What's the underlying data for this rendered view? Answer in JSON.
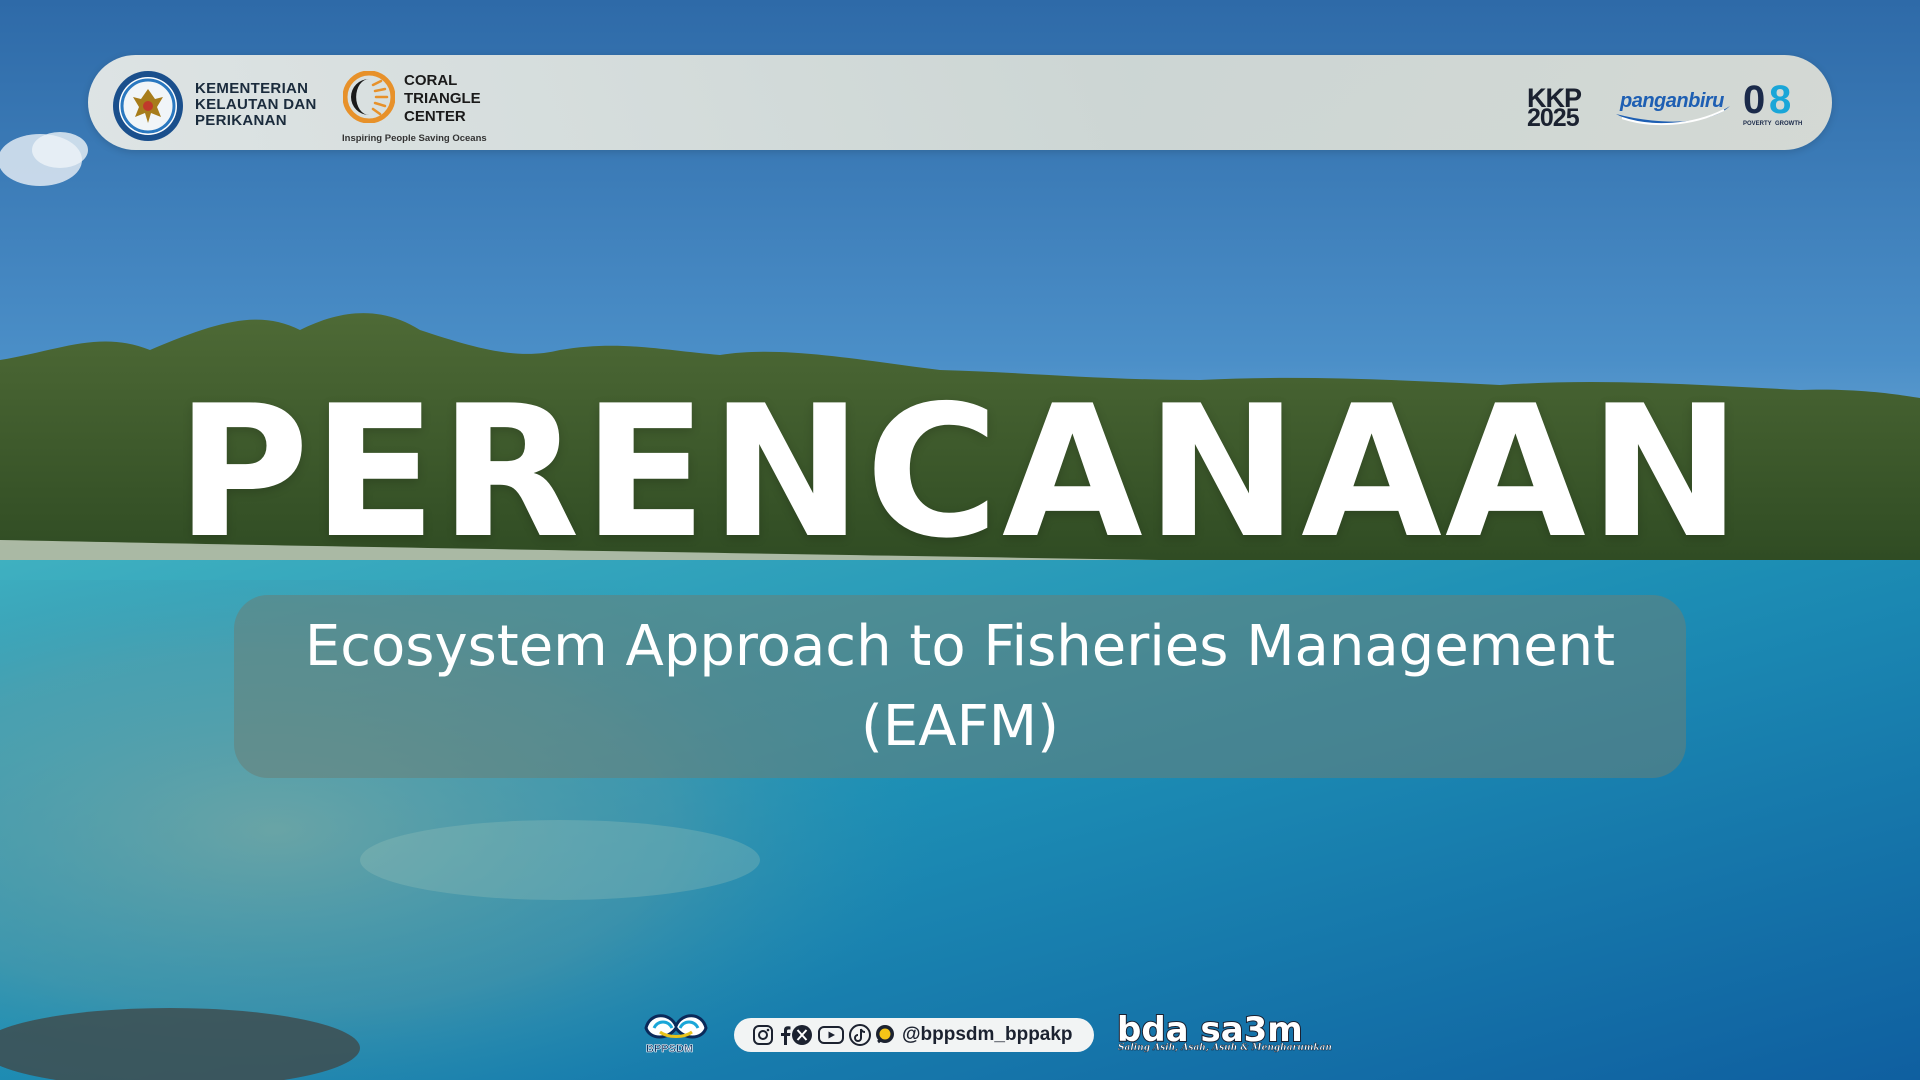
{
  "header": {
    "ministry_lines": "KEMENTERIAN\nKELAUTAN DAN\nPERIKANAN",
    "ctc_lines": "CORAL\nTRIANGLE\nCENTER",
    "ctc_tagline": "Inspiring People Saving Oceans",
    "badges": {
      "kkp_top": "KKP",
      "kkp_bottom": "2025",
      "panganbiru": "panganbiru",
      "o8_left": "0",
      "o8_right": "8",
      "o8_sub_left": "POVERTY",
      "o8_sub_right": "GROWTH"
    }
  },
  "main": {
    "title": "PERENCANAAN",
    "subtitle_line1": "Ecosystem Approach to Fisheries Management",
    "subtitle_line2": "(EAFM)"
  },
  "footer": {
    "bppsdm_label": "BPPSDM",
    "social_icons": [
      "instagram-icon",
      "facebook-icon",
      "x-icon",
      "youtube-icon",
      "tiktok-icon",
      "kakao-icon"
    ],
    "social_handle": "@bppsdm_bppakp",
    "bda_logo": "bda sa3m",
    "bda_tagline": "Saling Asih, Asah, Asuh & Mengharumkan"
  },
  "colors": {
    "sky_top": "#2f6fae",
    "sea_turquoise": "#1fa2b8",
    "sea_deep": "#1260a3",
    "subtitle_box": "#69806e",
    "title_text": "#ffffff"
  }
}
